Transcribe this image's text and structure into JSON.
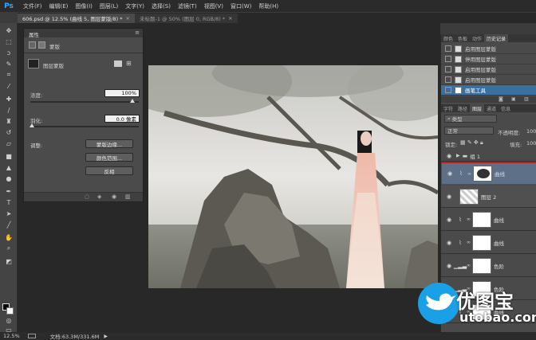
{
  "app": {
    "logo": "Ps"
  },
  "menu": [
    "文件(F)",
    "编辑(E)",
    "图像(I)",
    "图层(L)",
    "文字(Y)",
    "选择(S)",
    "滤镜(T)",
    "视图(V)",
    "窗口(W)",
    "帮助(H)"
  ],
  "tabs": [
    {
      "label": "606.psd @ 12.5% (曲线 5, 图层蒙版/8) *",
      "active": true
    },
    {
      "label": "未标题-1 @ 50% (图层 0, RGB/8) *",
      "active": false
    }
  ],
  "properties": {
    "title": "属性",
    "mask_mode": "蒙版",
    "layer_mask_label": "图层蒙版",
    "density_label": "浓度:",
    "density_value": "100%",
    "feather_label": "羽化:",
    "feather_value": "0.0 像素",
    "adjust_label": "调整:",
    "btn_mask_edge": "蒙版边缘...",
    "btn_color_range": "颜色范围...",
    "btn_invert": "反相"
  },
  "history_panel": {
    "tabs": [
      "颜色",
      "色板",
      "动作",
      "历史记录"
    ],
    "active_tab": "历史记录",
    "items": [
      {
        "label": "启用图层蒙版",
        "active": false
      },
      {
        "label": "停用图层蒙版",
        "active": false
      },
      {
        "label": "启用图层蒙版",
        "active": false
      },
      {
        "label": "启用图层蒙版",
        "active": false
      },
      {
        "label": "画笔工具",
        "active": true
      }
    ]
  },
  "layers_panel": {
    "tabs": [
      "字符",
      "路径",
      "图层",
      "通道",
      "信息"
    ],
    "active_tab": "图层",
    "kind_filter": "类型",
    "blend_mode": "正常",
    "opacity_label": "不透明度:",
    "opacity_value": "100",
    "lock_label": "锁定:",
    "fill_label": "填充:",
    "fill_value": "100",
    "layers": [
      {
        "name": "组 1",
        "type": "group"
      },
      {
        "name": "曲线",
        "type": "curves",
        "selected": true
      },
      {
        "name": "图层 2",
        "type": "pixel"
      },
      {
        "name": "曲线",
        "type": "curves"
      },
      {
        "name": "曲线",
        "type": "curves"
      },
      {
        "name": "色阶",
        "type": "levels"
      },
      {
        "name": "色阶",
        "type": "levels"
      },
      {
        "name": "曲线",
        "type": "curves"
      }
    ]
  },
  "status": {
    "zoom": "12.5%",
    "doc": "文档:63.3M/331.6M"
  },
  "watermark": {
    "brand": "优图宝",
    "url": "utobao.com"
  }
}
